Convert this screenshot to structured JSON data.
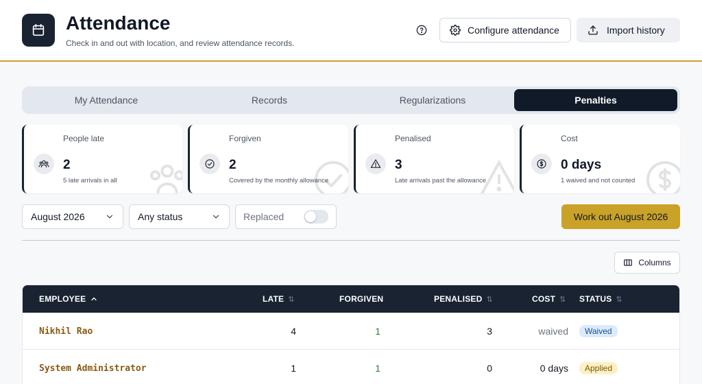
{
  "header": {
    "title": "Attendance",
    "subtitle": "Check in and out with location, and review attendance records.",
    "configure_label": "Configure attendance",
    "import_label": "Import history"
  },
  "tabs": [
    {
      "label": "My Attendance",
      "active": false
    },
    {
      "label": "Records",
      "active": false
    },
    {
      "label": "Regularizations",
      "active": false
    },
    {
      "label": "Penalties",
      "active": true
    }
  ],
  "stats": [
    {
      "label": "People late",
      "value": "2",
      "note": "5 late arrivals in all",
      "icon": "people-icon"
    },
    {
      "label": "Forgiven",
      "value": "2",
      "note": "Covered by the monthly allowance",
      "icon": "check-circle-icon"
    },
    {
      "label": "Penalised",
      "value": "3",
      "note": "Late arrivals past the allowance",
      "icon": "warning-icon"
    },
    {
      "label": "Cost",
      "value": "0 days",
      "note": "1 waived and not counted",
      "icon": "dollar-icon"
    }
  ],
  "filters": {
    "month": "August 2026",
    "status": "Any status",
    "replaced_label": "Replaced",
    "replaced_on": false
  },
  "work_out_label": "Work out August 2026",
  "columns_label": "Columns",
  "table": {
    "headers": {
      "employee": "EMPLOYEE",
      "late": "LATE",
      "forgiven": "FORGIVEN",
      "penalised": "PENALISED",
      "cost": "COST",
      "status": "STATUS"
    },
    "rows": [
      {
        "employee": "Nikhil Rao",
        "late": "4",
        "forgiven": "1",
        "penalised": "3",
        "cost": "waived",
        "status": "Waived"
      },
      {
        "employee": "System Administrator",
        "late": "1",
        "forgiven": "1",
        "penalised": "0",
        "cost": "0 days",
        "status": "Applied"
      }
    ]
  },
  "colors": {
    "accent": "#c9a227",
    "navy": "#1a2332",
    "waived_badge_bg": "#dbeafe",
    "waived_badge_fg": "#1e4f8c",
    "applied_badge_bg": "#fdf0c4",
    "applied_badge_fg": "#7a5a0a"
  }
}
